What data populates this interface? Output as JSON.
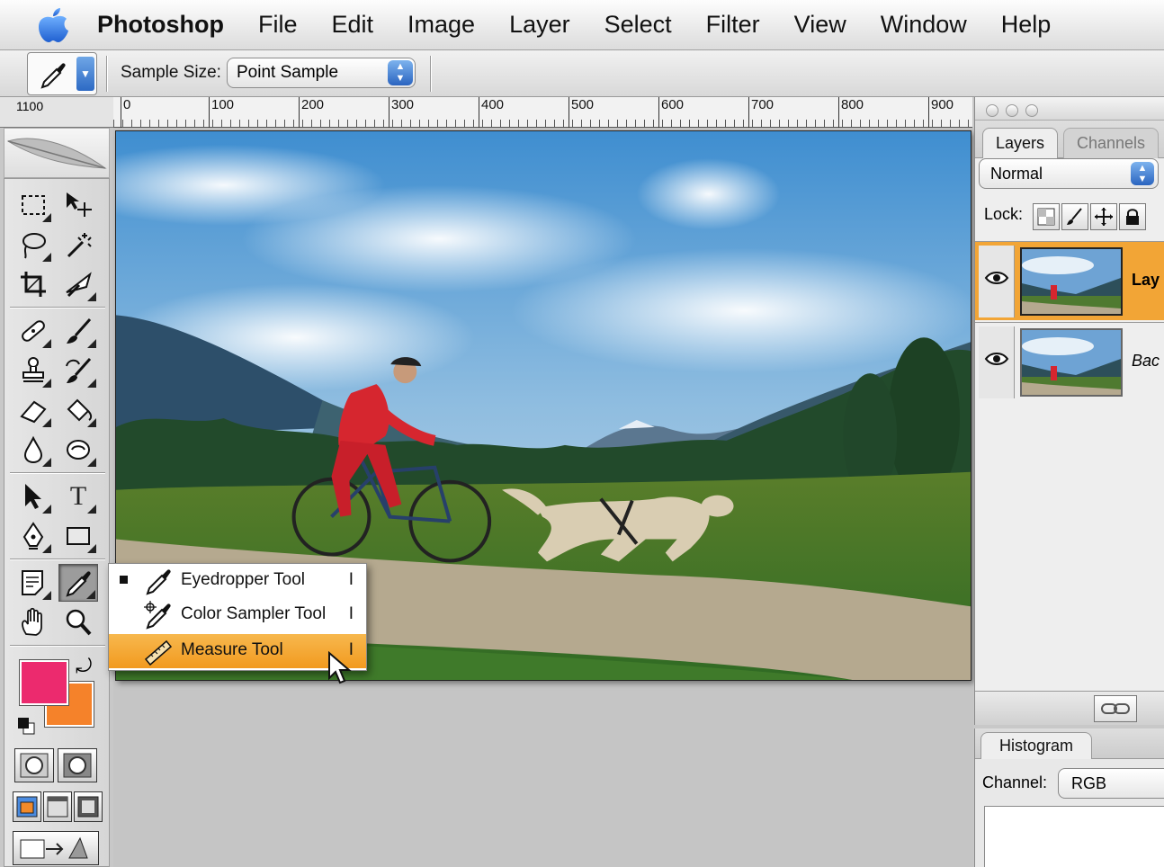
{
  "menubar": {
    "app_name": "Photoshop",
    "items": [
      "File",
      "Edit",
      "Image",
      "Layer",
      "Select",
      "Filter",
      "View",
      "Window",
      "Help"
    ]
  },
  "options_bar": {
    "sample_size_label": "Sample Size:",
    "sample_size_value": "Point Sample"
  },
  "ruler": {
    "corner_label": "1100",
    "ticks": [
      "0",
      "100",
      "200",
      "300",
      "400",
      "500",
      "600",
      "700",
      "800",
      "900"
    ]
  },
  "tools": {
    "type_glyph": "T",
    "foreground_color": "#ec2a6e",
    "background_color": "#f5822a"
  },
  "flyout": {
    "items": [
      {
        "label": "Eyedropper Tool",
        "key": "I",
        "current": true
      },
      {
        "label": "Color Sampler Tool",
        "key": "I",
        "current": false
      },
      {
        "label": "Measure Tool",
        "key": "I",
        "highlighted": true
      }
    ],
    "highlight_color": "#f29a1f"
  },
  "layers_panel": {
    "tabs": [
      "Layers",
      "Channels"
    ],
    "blend_mode": "Normal",
    "lock_label": "Lock:",
    "layers": [
      {
        "name": "Lay",
        "selected": true
      },
      {
        "name": "Bac",
        "selected": false
      }
    ]
  },
  "histogram_panel": {
    "tab": "Histogram",
    "channel_label": "Channel:",
    "channel_value": "RGB"
  }
}
